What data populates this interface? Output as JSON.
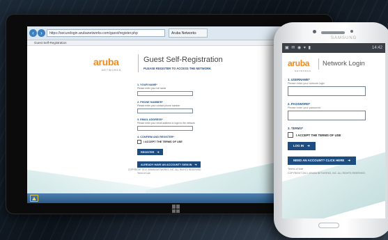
{
  "tablet": {
    "browser": {
      "address": "https://securelogin.arubanetworks.com/guest/register.php",
      "tab_label": "Aruba Networks",
      "favorites": "Guest Self-Registration"
    },
    "page": {
      "logo_text": "aruba",
      "logo_sub": "NETWORKS",
      "title": "Guest Self-Registration",
      "subtitle": "PLEASE REGISTER TO ACCESS THE NETWORK",
      "fields": [
        {
          "label": "1. YOUR NAME*",
          "hint": "Please enter your full name"
        },
        {
          "label": "2. PHONE NUMBER*",
          "hint": "Please enter your contact phone number"
        },
        {
          "label": "3. EMAIL ADDRESS*",
          "hint": "Please enter your email address to login to the network"
        }
      ],
      "confirm_label": "4. CONFIRM AND REGISTER*",
      "terms_label": "I ACCEPT THE TERMS OF USE",
      "register_button": "REGISTER",
      "signin_button": "ALREADY HAVE AN ACCOUNT? SIGN IN",
      "small_link": "Terms of Use",
      "copyright": "COPYRIGHT 2013, ARUBA NETWORKS, INC. ALL RIGHTS RESERVED."
    }
  },
  "phone": {
    "brand": "SAMSUNG",
    "status_time": "14:42",
    "status_icons": "▣ ✉ ◉ ▾ ▮",
    "logo_text": "aruba",
    "logo_sub": "NETWORKS",
    "title": "Network Login",
    "fields": [
      {
        "label": "1. USERNAME*",
        "hint": "Please enter your network login"
      },
      {
        "label": "2. PASSWORD*",
        "hint": "Please enter your password"
      }
    ],
    "terms_section": "3. TERMS*",
    "terms_label": "I ACCEPT THE TERMS OF USE",
    "login_button": "LOG IN",
    "register_button": "NEED AN ACCOUNT? CLICK HERE",
    "small_link": "Terms of Use",
    "copyright": "COPYRIGHT 2013, ARUBA NETWORKS, INC. ALL RIGHTS RESERVED."
  },
  "colors": {
    "brand_orange": "#f08a1c",
    "brand_blue": "#1d4c80"
  }
}
